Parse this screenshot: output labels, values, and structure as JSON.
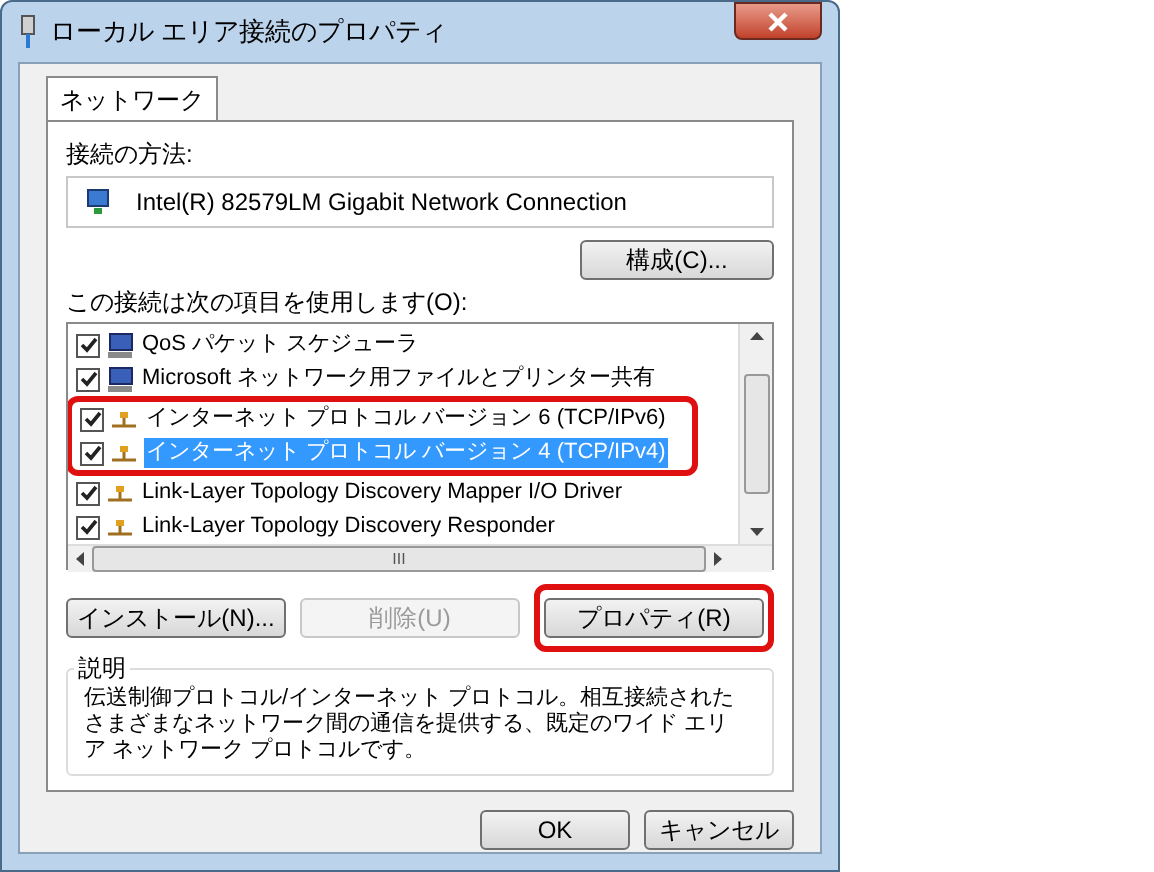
{
  "window": {
    "title": "ローカル エリア接続のプロパティ"
  },
  "tabs": [
    {
      "label": "ネットワーク",
      "selected": true
    }
  ],
  "connect_using": {
    "label": "接続の方法:",
    "adapter": "Intel(R) 82579LM Gigabit Network Connection",
    "configure_button": "構成(C)..."
  },
  "items_label": "この接続は次の項目を使用します(O):",
  "items": [
    {
      "label": "QoS パケット スケジューラ",
      "kind": "service",
      "checked": true,
      "selected": false,
      "callout": false
    },
    {
      "label": "Microsoft ネットワーク用ファイルとプリンター共有",
      "kind": "service",
      "checked": true,
      "selected": false,
      "callout": false
    },
    {
      "label": "インターネット プロトコル バージョン 6 (TCP/IPv6)",
      "kind": "protocol",
      "checked": true,
      "selected": false,
      "callout": true
    },
    {
      "label": "インターネット プロトコル バージョン 4 (TCP/IPv4)",
      "kind": "protocol",
      "checked": true,
      "selected": true,
      "callout": true
    },
    {
      "label": "Link-Layer Topology Discovery Mapper I/O Driver",
      "kind": "protocol",
      "checked": true,
      "selected": false,
      "callout": false
    },
    {
      "label": "Link-Layer Topology Discovery Responder",
      "kind": "protocol",
      "checked": true,
      "selected": false,
      "callout": false
    }
  ],
  "scroll_grip": "III",
  "action_buttons": [
    {
      "label": "インストール(N)...",
      "disabled": false,
      "callout": false
    },
    {
      "label": "削除(U)",
      "disabled": true,
      "callout": false
    },
    {
      "label": "プロパティ(R)",
      "disabled": false,
      "callout": true
    }
  ],
  "description": {
    "label": "説明",
    "text": "伝送制御プロトコル/インターネット プロトコル。相互接続されたさまざまなネットワーク間の通信を提供する、既定のワイド エリア ネットワーク プロトコルです。"
  },
  "dialog_buttons": [
    {
      "label": "OK"
    },
    {
      "label": "キャンセル"
    }
  ]
}
